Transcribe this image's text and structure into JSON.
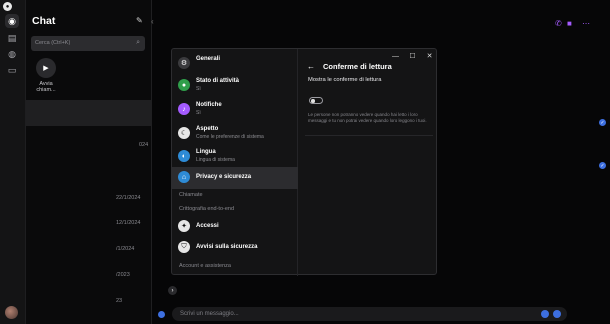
{
  "window": {
    "controls": [
      "—",
      "❐",
      "✕"
    ]
  },
  "rail": {
    "items": [
      "chat-icon",
      "store-icon",
      "bubble-icon",
      "archive-icon"
    ]
  },
  "chatlist": {
    "title": "Chat",
    "search_placeholder": "Cerca (Ctrl+K)",
    "start_call_label": "Avvia chiam...",
    "dates": [
      "024",
      "22/1/2024",
      "12/1/2024",
      "/1/2024",
      "/2023",
      "23"
    ]
  },
  "conversation": {
    "message_placeholder": "Scrivi un messaggio..."
  },
  "settings": {
    "controls": [
      "—",
      "☐",
      "✕"
    ],
    "menu": [
      {
        "title": "Generali",
        "subtitle": ""
      },
      {
        "title": "Stato di attività",
        "subtitle": "Sì"
      },
      {
        "title": "Notifiche",
        "subtitle": "Sì"
      },
      {
        "title": "Aspetto",
        "subtitle": "Come le preferenze di sistema"
      },
      {
        "title": "Lingua",
        "subtitle": "Lingua di sistema"
      },
      {
        "title": "Privacy e sicurezza",
        "subtitle": ""
      },
      {
        "title": "Accessi",
        "subtitle": ""
      },
      {
        "title": "Avvisi sulla sicurezza",
        "subtitle": ""
      }
    ],
    "sub_labels": [
      "Chiamate",
      "Crittografia end-to-end",
      "Account e assistenza"
    ],
    "pane": {
      "title": "Conferme di lettura",
      "option_label": "Mostra le conferme di lettura",
      "toggle_on": false,
      "description": "Le persone non potranno vedere quando hai letto i loro messaggi e tu non potrai vedere quando loro leggono i tuoi."
    }
  },
  "colors": {
    "accent": "#a45bff",
    "blue": "#3d6fe0"
  }
}
